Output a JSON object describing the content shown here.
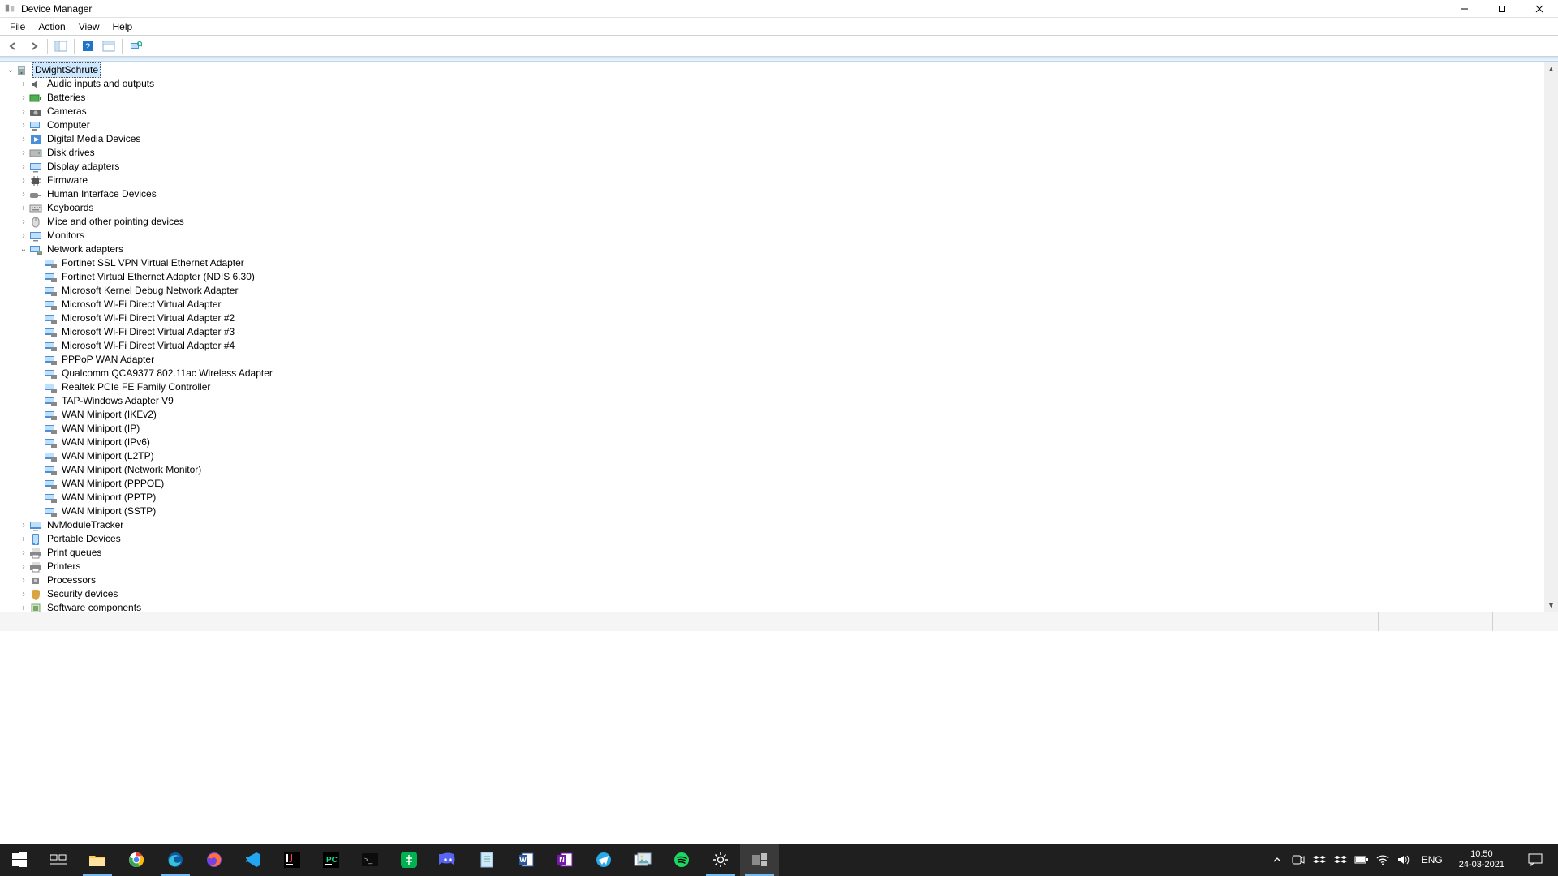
{
  "title": "Device Manager",
  "menu": [
    "File",
    "Action",
    "View",
    "Help"
  ],
  "root": {
    "label": "DwightSchrute"
  },
  "categories": [
    {
      "label": "Audio inputs and outputs",
      "icon": "audio"
    },
    {
      "label": "Batteries",
      "icon": "battery"
    },
    {
      "label": "Cameras",
      "icon": "camera"
    },
    {
      "label": "Computer",
      "icon": "computer"
    },
    {
      "label": "Digital Media Devices",
      "icon": "media"
    },
    {
      "label": "Disk drives",
      "icon": "disk"
    },
    {
      "label": "Display adapters",
      "icon": "display"
    },
    {
      "label": "Firmware",
      "icon": "chip"
    },
    {
      "label": "Human Interface Devices",
      "icon": "hid"
    },
    {
      "label": "Keyboards",
      "icon": "keyboard"
    },
    {
      "label": "Mice and other pointing devices",
      "icon": "mouse"
    },
    {
      "label": "Monitors",
      "icon": "monitor"
    },
    {
      "label": "Network adapters",
      "icon": "network",
      "expanded": true,
      "children": [
        "Fortinet SSL VPN Virtual Ethernet Adapter",
        "Fortinet Virtual Ethernet Adapter (NDIS 6.30)",
        "Microsoft Kernel Debug Network Adapter",
        "Microsoft Wi-Fi Direct Virtual Adapter",
        "Microsoft Wi-Fi Direct Virtual Adapter #2",
        "Microsoft Wi-Fi Direct Virtual Adapter #3",
        "Microsoft Wi-Fi Direct Virtual Adapter #4",
        "PPPoP WAN Adapter",
        "Qualcomm QCA9377 802.11ac Wireless Adapter",
        "Realtek PCIe FE Family Controller",
        "TAP-Windows Adapter V9",
        "WAN Miniport (IKEv2)",
        "WAN Miniport (IP)",
        "WAN Miniport (IPv6)",
        "WAN Miniport (L2TP)",
        "WAN Miniport (Network Monitor)",
        "WAN Miniport (PPPOE)",
        "WAN Miniport (PPTP)",
        "WAN Miniport (SSTP)"
      ]
    },
    {
      "label": "NvModuleTracker",
      "icon": "display"
    },
    {
      "label": "Portable Devices",
      "icon": "portable"
    },
    {
      "label": "Print queues",
      "icon": "printer"
    },
    {
      "label": "Printers",
      "icon": "printer"
    },
    {
      "label": "Processors",
      "icon": "cpu"
    },
    {
      "label": "Security devices",
      "icon": "security"
    },
    {
      "label": "Software components",
      "icon": "software"
    }
  ],
  "tray": {
    "lang": "ENG",
    "time": "10:50",
    "date": "24-03-2021"
  }
}
